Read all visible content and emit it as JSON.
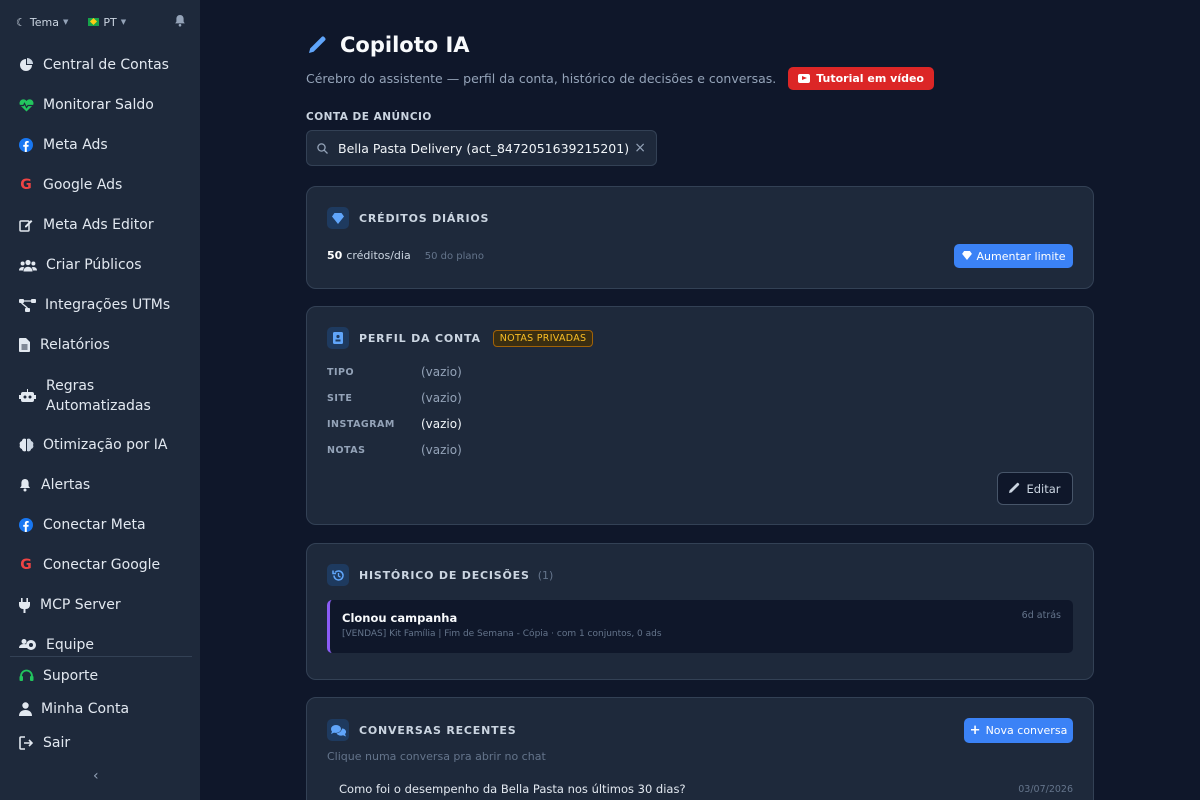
{
  "sidebar": {
    "theme_label": "Tema",
    "lang_label": "PT",
    "items": [
      {
        "label": "Central de Contas",
        "icon": "pie-chart-icon"
      },
      {
        "label": "Monitorar Saldo",
        "icon": "heart-pulse-icon"
      },
      {
        "label": "Meta Ads",
        "icon": "facebook-icon"
      },
      {
        "label": "Google Ads",
        "icon": "google-icon"
      },
      {
        "label": "Meta Ads Editor",
        "icon": "edit-icon"
      },
      {
        "label": "Criar Públicos",
        "icon": "users-icon"
      },
      {
        "label": "Integrações UTMs",
        "icon": "network-icon"
      },
      {
        "label": "Relatórios",
        "icon": "file-icon"
      },
      {
        "label": "Regras Automatizadas",
        "icon": "robot-icon"
      },
      {
        "label": "Otimização por IA",
        "icon": "brain-icon"
      },
      {
        "label": "Alertas",
        "icon": "bell-icon"
      },
      {
        "label": "Conectar Meta",
        "icon": "facebook-icon"
      },
      {
        "label": "Conectar Google",
        "icon": "google-icon"
      },
      {
        "label": "MCP Server",
        "icon": "plug-icon"
      },
      {
        "label": "Equipe",
        "icon": "team-icon"
      }
    ],
    "bottom_items": [
      {
        "label": "Suporte",
        "icon": "headset-icon"
      },
      {
        "label": "Minha Conta",
        "icon": "user-icon"
      },
      {
        "label": "Sair",
        "icon": "logout-icon"
      }
    ]
  },
  "header": {
    "title": "Copiloto IA",
    "subtitle": "Cérebro do assistente — perfil da conta, histórico de decisões e conversas.",
    "tutorial_label": "Tutorial em vídeo"
  },
  "account": {
    "label": "CONTA DE ANÚNCIO",
    "selected": "Bella Pasta Delivery (act_8472051639215201)"
  },
  "credits": {
    "title": "CRÉDITOS DIÁRIOS",
    "amount": "50",
    "unit": "créditos/dia",
    "plan": "50 do plano",
    "button": "Aumentar limite"
  },
  "profile": {
    "title": "PERFIL DA CONTA",
    "badge": "NOTAS PRIVADAS",
    "fields": [
      {
        "key": "TIPO",
        "value": "(vazio)"
      },
      {
        "key": "SITE",
        "value": "(vazio)"
      },
      {
        "key": "INSTAGRAM",
        "value": "(vazio)"
      },
      {
        "key": "NOTAS",
        "value": "(vazio)"
      }
    ],
    "edit_label": "Editar"
  },
  "history": {
    "title": "HISTÓRICO DE DECISÕES",
    "count": "(1)",
    "items": [
      {
        "title": "Clonou campanha",
        "meta": "[VENDAS] Kit Família | Fim de Semana - Cópia · com 1 conjuntos, 0 ads",
        "time": "6d atrás"
      }
    ]
  },
  "conversations": {
    "title": "CONVERSAS RECENTES",
    "new_button": "Nova conversa",
    "hint": "Clique numa conversa pra abrir no chat",
    "items": [
      {
        "text": "Como foi o desempenho da Bella Pasta nos últimos 30 dias?",
        "date": "03/07/2026"
      }
    ]
  },
  "colors": {
    "accent": "#3b82f6",
    "danger": "#dc2626",
    "decision_border": "#8b5cf6",
    "badge": "#fbbf24"
  }
}
